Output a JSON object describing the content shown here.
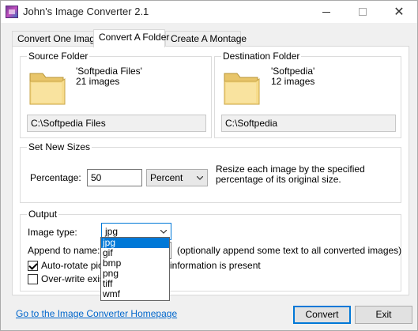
{
  "window": {
    "title": "John's Image Converter 2.1",
    "min_glyph": "—",
    "close_glyph": "✕"
  },
  "tabs": [
    {
      "label": "Convert One Image"
    },
    {
      "label": "Convert A Folder"
    },
    {
      "label": "Create A Montage"
    }
  ],
  "source": {
    "label": "Source Folder",
    "name": "'Softpedia Files'",
    "count": "21 images",
    "path": "C:\\Softpedia Files"
  },
  "destination": {
    "label": "Destination Folder",
    "name": "'Softpedia'",
    "count": "12 images",
    "path": "C:\\Softpedia"
  },
  "sizes": {
    "label": "Set New Sizes",
    "percentage_label": "Percentage:",
    "percentage_value": "50",
    "unit_selected": "Percent",
    "description": "Resize each image by the specified percentage of its original size."
  },
  "output": {
    "label": "Output",
    "image_type_label": "Image type:",
    "image_type_selected": "jpg",
    "image_type_options": [
      "jpg",
      "gif",
      "bmp",
      "png",
      "tiff",
      "wmf"
    ],
    "append_label": "Append to name:",
    "append_hint": "(optionally append some text to all converted images)",
    "autorotate_label_left": "Auto-rotate pictu",
    "autorotate_label_right": "information is present",
    "autorotate_checked": true,
    "overwrite_label": "Over-write exis",
    "overwrite_checked": false
  },
  "footer": {
    "homepage_link": "Go to the Image Converter Homepage",
    "convert_button": "Convert",
    "exit_button": "Exit"
  }
}
